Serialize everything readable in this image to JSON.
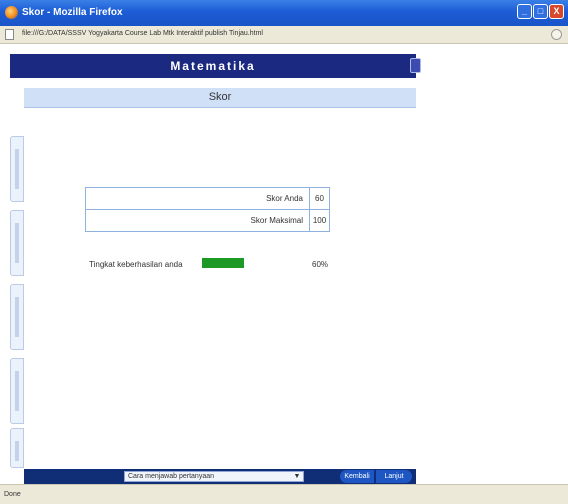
{
  "window": {
    "title": "Skor - Mozilla Firefox",
    "controls": {
      "minimize": "_",
      "maximize": "□",
      "close": "X"
    }
  },
  "address_bar": {
    "url": "file:///G:/DATA/SSSV Yogyakarta Course Lab Mtk Interaktif publish Tinjau.html"
  },
  "app": {
    "header_title": "Matematika",
    "section_title": "Skor",
    "score_table": {
      "rows": [
        {
          "label": "Skor Anda",
          "value": "60"
        },
        {
          "label": "Skor Maksimal",
          "value": "100"
        }
      ]
    },
    "progress": {
      "label": "Tingkat keberhasilan anda",
      "fraction": 0.6,
      "text": "60%"
    },
    "bottom_bar": {
      "status": "",
      "select_value": "Cara menjawab pertanyaan",
      "prev_label": "Kembali",
      "next_label": "Lanjut"
    }
  },
  "status_bar": {
    "text": "Done"
  },
  "colors": {
    "header": "#1c2980",
    "subheader": "#cfe0f7",
    "progress": "#1c9a25",
    "titlebar": "#1c5cd6"
  }
}
